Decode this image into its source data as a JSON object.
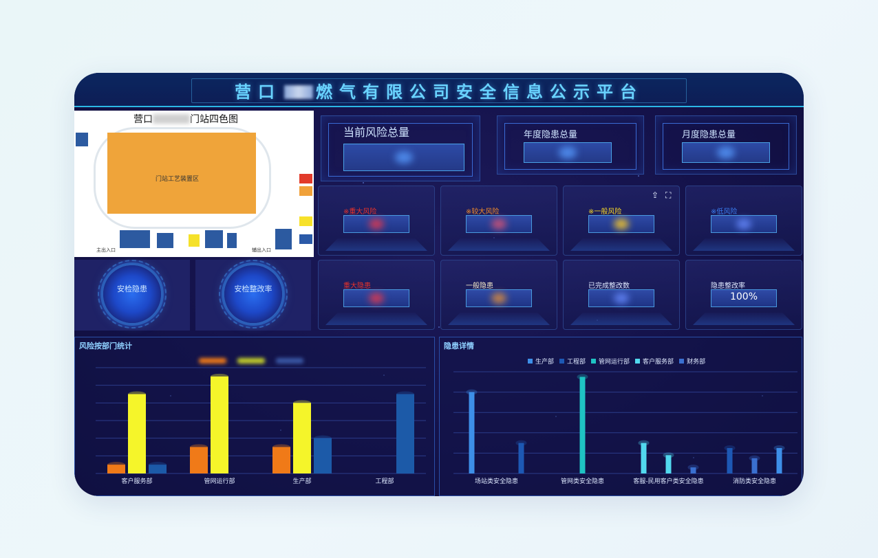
{
  "header": {
    "title_part1": "营口",
    "title_part2": "燃气有限公司安全信息公示平台"
  },
  "map": {
    "title_part1": "营口",
    "title_part2": "门站四色图",
    "zone_label": "门站工艺装置区",
    "main_entrance": "主出入口",
    "aux_entrance": "辅出入口",
    "colors": [
      "#e23b2b",
      "#f0a13a",
      "#f7e12a",
      "#2b5aa8"
    ]
  },
  "gauges": [
    {
      "label": "安检隐患"
    },
    {
      "label": "安检整改率"
    }
  ],
  "stats": [
    {
      "label": "当前风险总量"
    },
    {
      "label": "年度隐患总量"
    },
    {
      "label": "月度隐患总量"
    }
  ],
  "risk_cards": [
    {
      "label": "※重大风险",
      "color": "#e8322a"
    },
    {
      "label": "※较大风险",
      "color": "#f08a2a"
    },
    {
      "label": "※一般风险",
      "color": "#f5d628"
    },
    {
      "label": "※低风险",
      "color": "#3a7cf0"
    }
  ],
  "hazard_cards": [
    {
      "label": "重大隐患",
      "color": "#e8322a",
      "value": ""
    },
    {
      "label": "一般隐患",
      "color": "#f3e9c8",
      "value": ""
    },
    {
      "label": "已完成整改数",
      "color": "#dfe9ff",
      "value": ""
    },
    {
      "label": "隐患整改率",
      "color": "#dfe9ff",
      "value": "100%"
    }
  ],
  "toolbar": {
    "export_icon": "export-icon",
    "fullscreen_icon": "fullscreen-icon"
  },
  "chart_left": {
    "title": "风险按部门统计",
    "chart_data": {
      "type": "bar",
      "categories": [
        "客户服务部",
        "管网运行部",
        "生产部",
        "工程部"
      ],
      "series": [
        {
          "color": "#f07a18",
          "values": [
            1,
            3,
            3,
            0
          ]
        },
        {
          "color": "#f5f52a",
          "values": [
            9,
            11,
            8,
            0
          ]
        },
        {
          "color": "#1c5aa8",
          "values": [
            1,
            0,
            4,
            9
          ]
        }
      ],
      "ylim": [
        0,
        12
      ],
      "grid": true
    }
  },
  "chart_right": {
    "title": "隐患详情",
    "chart_data": {
      "type": "bar",
      "categories": [
        "场站类安全隐患",
        "管网类安全隐患",
        "客服-民用客户类安全隐患",
        "消防类安全隐患"
      ],
      "series": [
        {
          "name": "生产部",
          "color": "#3d8fe8",
          "values": [
            8,
            0,
            0,
            0
          ]
        },
        {
          "name": "工程部",
          "color": "#1d58b4",
          "values": [
            3,
            0,
            0,
            2.5
          ]
        },
        {
          "name": "管网运行部",
          "color": "#1fc3c3",
          "values": [
            0,
            9.5,
            0,
            0
          ]
        },
        {
          "name": "客户服务部",
          "color": "#52d8ee",
          "values": [
            0,
            0,
            3,
            0
          ]
        },
        {
          "name": "财务部",
          "color": "#3a6fd0",
          "values": [
            0,
            0,
            0,
            1.5
          ]
        }
      ],
      "extra_bars": [
        {
          "category_index": 2,
          "color": "#52d8ee",
          "value": 1.8
        },
        {
          "category_index": 2,
          "color": "#3a6fd0",
          "value": 0.6
        },
        {
          "category_index": 3,
          "color": "#3d8fe8",
          "value": 2.5
        }
      ],
      "ylim": [
        0,
        10
      ],
      "grid": true,
      "legend_position": "top"
    }
  }
}
